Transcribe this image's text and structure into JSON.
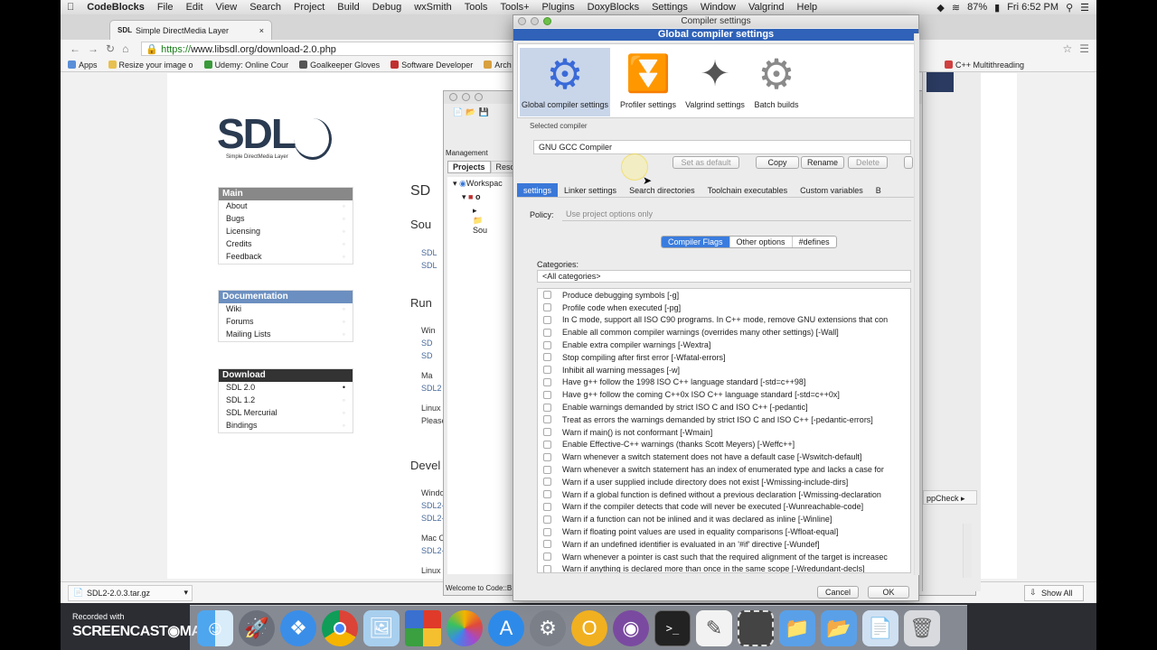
{
  "menubar": {
    "items": [
      "CodeBlocks",
      "File",
      "Edit",
      "View",
      "Search",
      "Project",
      "Build",
      "Debug",
      "wxSmith",
      "Tools",
      "Tools+",
      "Plugins",
      "DoxyBlocks",
      "Settings",
      "Window",
      "Valgrind",
      "Help"
    ],
    "battery": "87%",
    "clock": "Fri 6:52 PM"
  },
  "browser": {
    "tab_title": "Simple DirectMedia Layer",
    "url_scheme": "https://",
    "url_rest": "www.libsdl.org/download-2.0.php",
    "bookmarks": [
      "Apps",
      "Resize your image o",
      "Udemy: Online Cour",
      "Goalkeeper Gloves",
      "Software Developer",
      "Arch",
      "C++ Multithreading"
    ]
  },
  "webpage": {
    "logo": "SDL",
    "logo_sub": "Simple DirectMedia Layer",
    "nav": [
      {
        "head": "Main",
        "items": [
          "About",
          "Bugs",
          "Licensing",
          "Credits",
          "Feedback"
        ]
      },
      {
        "head": "Documentation",
        "items": [
          "Wiki",
          "Forums",
          "Mailing Lists"
        ]
      },
      {
        "head": "Download",
        "items": [
          "SDL 2.0",
          "SDL 1.2",
          "SDL Mercurial",
          "Bindings"
        ]
      }
    ],
    "headings": [
      "SD",
      "Sou",
      "Run",
      "Devel"
    ],
    "snippets": [
      "SDL",
      "SDL",
      "Win",
      "SD",
      "SD",
      "Ma",
      "SDL2",
      "Linux",
      "Please",
      "Windo",
      "SDL2-",
      "SDL2-",
      "Mac O",
      "SDL2-",
      "Linux"
    ]
  },
  "downloads": {
    "file": "SDL2-2.0.3.tar.gz",
    "show_all": "Show All"
  },
  "codeblocks": {
    "panel_title": "Management",
    "tabs": [
      "Projects",
      "Reso"
    ],
    "tree": [
      "Workspac",
      "o",
      "Sou"
    ],
    "log_tab": "Welcome to Code::B",
    "side_label": "ppCheck"
  },
  "dialog": {
    "window_title": "Compiler settings",
    "banner": "Global compiler settings",
    "sections": [
      {
        "label": "Global compiler settings",
        "icon": "gear-icon"
      },
      {
        "label": "Profiler settings",
        "icon": "profiler-icon"
      },
      {
        "label": "Valgrind settings",
        "icon": "valgrind-icon"
      },
      {
        "label": "Batch builds",
        "icon": "batch-gear-icon"
      }
    ],
    "selected_compiler_label": "Selected compiler",
    "selected_compiler": "GNU GCC Compiler",
    "buttons": {
      "set_default": "Set as default",
      "copy": "Copy",
      "rename": "Rename",
      "delete": "Delete"
    },
    "tabs": [
      "settings",
      "Linker settings",
      "Search directories",
      "Toolchain executables",
      "Custom variables",
      "B"
    ],
    "policy_label": "Policy:",
    "policy_value": "Use project options only",
    "subtabs": [
      "Compiler Flags",
      "Other options",
      "#defines"
    ],
    "categories_label": "Categories:",
    "categories_value": "<All categories>",
    "flags": [
      "Produce debugging symbols  [-g]",
      "Profile code when executed  [-pg]",
      "In C mode, support all ISO C90 programs. In C++ mode, remove GNU extensions that con",
      "Enable all common compiler warnings (overrides many other settings)  [-Wall]",
      "Enable extra compiler warnings  [-Wextra]",
      "Stop compiling after first error  [-Wfatal-errors]",
      "Inhibit all warning messages  [-w]",
      "Have g++ follow the 1998 ISO C++ language standard  [-std=c++98]",
      "Have g++ follow the coming C++0x ISO C++ language standard  [-std=c++0x]",
      "Enable warnings demanded by strict ISO C and ISO C++  [-pedantic]",
      "Treat as errors the warnings demanded by strict ISO C and ISO C++  [-pedantic-errors]",
      "Warn if main() is not conformant  [-Wmain]",
      "Enable Effective-C++ warnings (thanks Scott Meyers)  [-Weffc++]",
      "Warn whenever a switch statement does not have a default case  [-Wswitch-default]",
      "Warn whenever a switch statement has an index of enumerated type and lacks a case for",
      "Warn if a user supplied include directory does not exist  [-Wmissing-include-dirs]",
      "Warn if a global function is defined without a previous declaration  [-Wmissing-declaration",
      "Warn if the compiler detects that code will never be executed  [-Wunreachable-code]",
      "Warn if a function can not be inlined and it was declared as inline  [-Winline]",
      "Warn if floating point values are used in equality comparisons  [-Wfloat-equal]",
      "Warn if an undefined identifier is evaluated in an '#if' directive  [-Wundef]",
      "Warn whenever a pointer is cast such that the required alignment of the target is increasec",
      "Warn if anything is declared more than once in the same scope  [-Wredundant-decls]"
    ],
    "cancel": "Cancel",
    "ok": "OK"
  },
  "watermark": {
    "line1": "Recorded with",
    "line2": "SCREENCAST◉MATIC"
  },
  "colors": {
    "accent": "#3a78d8",
    "banner": "#2f62b8",
    "nav_head_gray": "#888888",
    "nav_head_blue": "#6b8fc0",
    "nav_head_dark": "#333333"
  }
}
